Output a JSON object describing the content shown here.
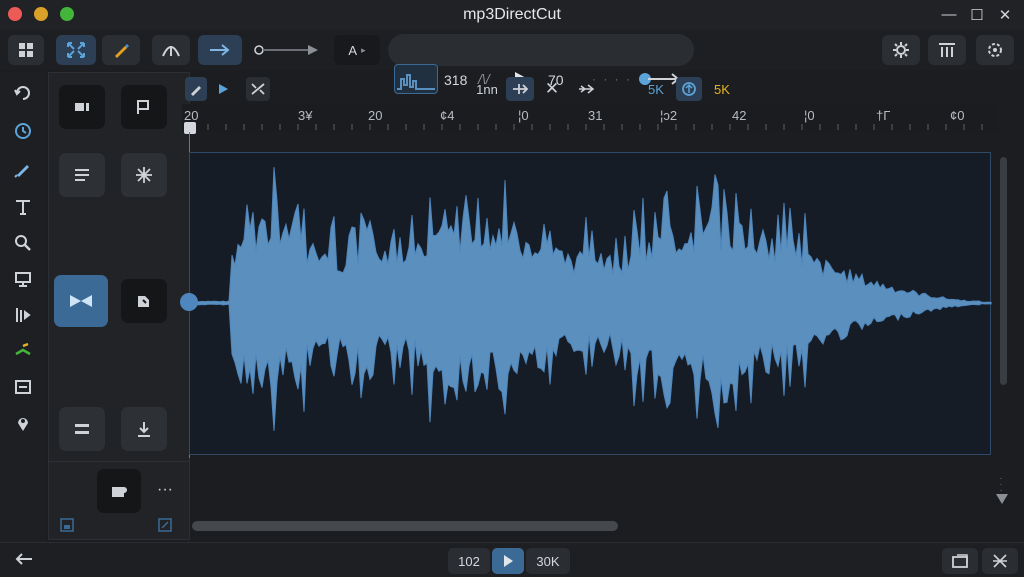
{
  "window": {
    "title": "mp3DirectCut"
  },
  "toolbar": {
    "a_label": "A",
    "time_a": "318",
    "time_b": "70"
  },
  "subtool": {
    "lm_label": "1nn",
    "sk1": "5K",
    "sk2": "5K"
  },
  "ruler": {
    "ticks": [
      "20",
      "3¥",
      "20",
      "¢4",
      "¦0",
      "31",
      "¦ɔ2",
      "42",
      "¦0",
      "†Γ",
      "¢0"
    ]
  },
  "status": {
    "left_value": "102",
    "right_value": "30K"
  },
  "colors": {
    "accent": "#5ba3d8",
    "selected": "#3b6a96",
    "waveform": "#5b8fbe",
    "yellow": "#e6b422"
  }
}
